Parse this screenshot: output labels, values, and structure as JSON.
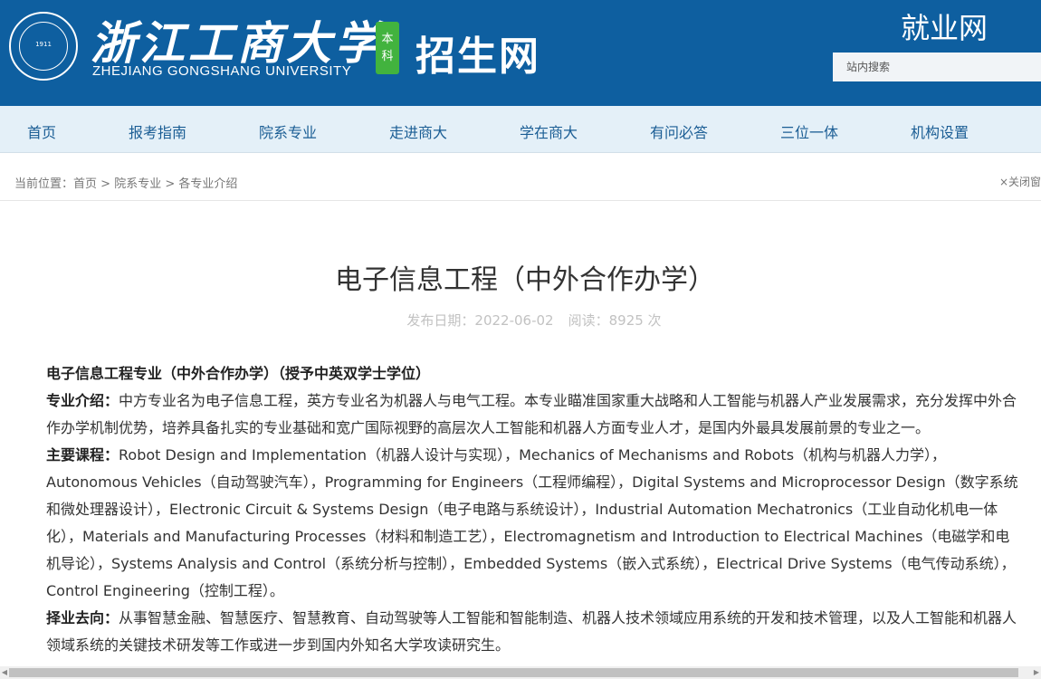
{
  "header": {
    "university_cn": "浙江工商大学",
    "university_en": "ZHEJIANG GONGSHANG UNIVERSITY",
    "seal_year": "1911",
    "badge_line1": "本",
    "badge_line2": "科",
    "site_name": "招生网",
    "jobs_link": "就业网",
    "search_placeholder": "站内搜索",
    "bg_color": "#0e5fa0"
  },
  "nav": {
    "items": [
      {
        "label": "首页"
      },
      {
        "label": "报考指南"
      },
      {
        "label": "院系专业"
      },
      {
        "label": "走进商大"
      },
      {
        "label": "学在商大"
      },
      {
        "label": "有问必答"
      },
      {
        "label": "三位一体"
      },
      {
        "label": "机构设置"
      }
    ]
  },
  "breadcrumb": {
    "prefix": "当前位置：",
    "items": [
      "首页",
      "院系专业",
      "各专业介绍"
    ],
    "separator": " > ",
    "close_label": "×关闭窗"
  },
  "article": {
    "title": "电子信息工程（中外合作办学）",
    "publish_date": "发布日期：2022-06-02",
    "views": "阅读：8925 次",
    "heading": "电子信息工程专业（中外合作办学）（授予中英双学士学位）",
    "intro_label": "专业介绍：",
    "intro_text": "中方专业名为电子信息工程，英方专业名为机器人与电气工程。本专业瞄准国家重大战略和人工智能与机器人产业发展需求，充分发挥中外合作办学机制优势，培养具备扎实的专业基础和宽广国际视野的高层次人工智能和机器人方面专业人才，是国内外最具发展前景的专业之一。",
    "courses_label": "主要课程：",
    "courses_text": "Robot Design and Implementation（机器人设计与实现），Mechanics of Mechanisms and Robots（机构与机器人力学），Autonomous Vehicles（自动驾驶汽车），Programming for Engineers（工程师编程），Digital Systems and Microprocessor Design（数字系统和微处理器设计），Electronic Circuit & Systems Design（电子电路与系统设计），Industrial Automation Mechatronics（工业自动化机电一体化），Materials and Manufacturing Processes（材料和制造工艺），Electromagnetism and Introduction to Electrical Machines（电磁学和电机导论），Systems Analysis and Control（系统分析与控制），Embedded Systems（嵌入式系统），Electrical Drive Systems（电气传动系统），Control Engineering（控制工程）。",
    "career_label": "择业去向：",
    "career_text": "从事智慧金融、智慧医疗、智慧教育、自动驾驶等人工智能和智能制造、机器人技术领域应用系统的开发和技术管理，以及人工智能和机器人领域系统的关键技术研发等工作或进一步到国内外知名大学攻读研究生。"
  }
}
